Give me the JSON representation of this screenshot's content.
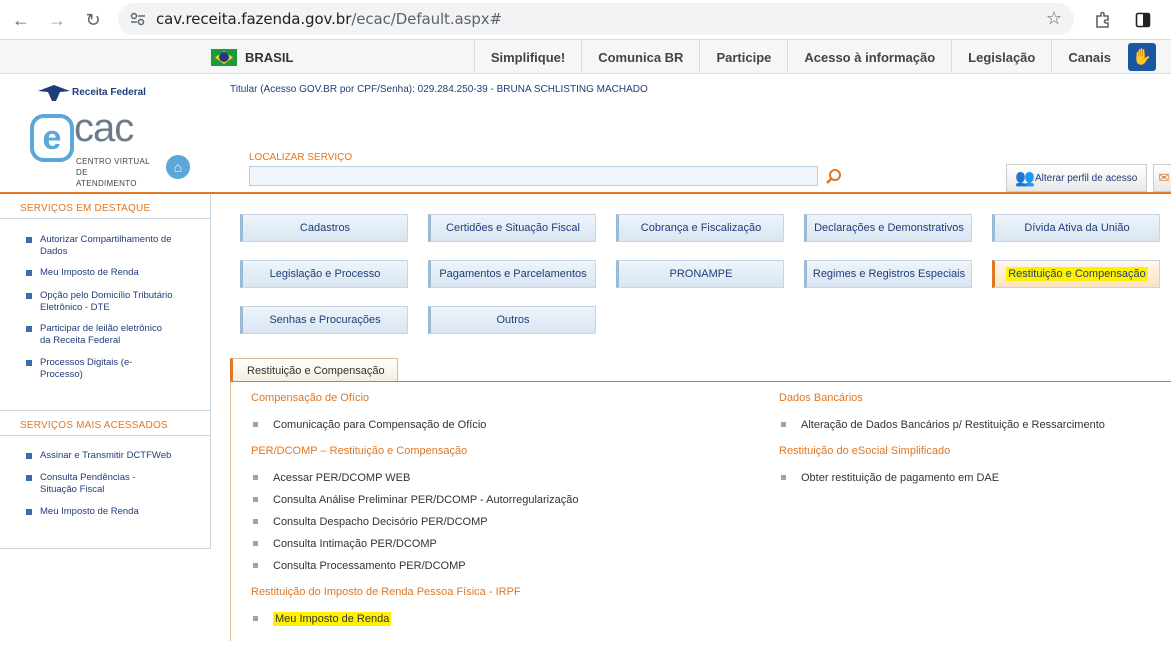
{
  "browser": {
    "url_host": "cav.receita.fazenda.gov.br",
    "url_path": "/ecac/Default.aspx#"
  },
  "gov_bar": {
    "country": "BRASIL",
    "links": [
      "Simplifique!",
      "Comunica BR",
      "Participe",
      "Acesso à informação",
      "Legislação",
      "Canais"
    ]
  },
  "header": {
    "rf_logo_text": "Receita Federal",
    "ecac_e": "e",
    "ecac_cac": "cac",
    "ecac_sub1": "CENTRO VIRTUAL",
    "ecac_sub2": "DE ATENDIMENTO",
    "titular": "Titular (Acesso GOV.BR por CPF/Senha): 029.284.250-39 - BRUNA SCHLISTING MACHADO",
    "search_label": "LOCALIZAR SERVIÇO",
    "search_value": "",
    "profile_button": "Alterar perfil de acesso"
  },
  "sidebar": {
    "featured_title": "SERVIÇOS EM DESTAQUE",
    "featured": [
      [
        "Autorizar Compartilhamento de",
        "Dados"
      ],
      [
        "Meu Imposto de Renda"
      ],
      [
        "Opção pelo Domicílio Tributário",
        "Eletrônico - DTE"
      ],
      [
        "Participar de leilão eletrônico",
        "da Receita Federal"
      ],
      [
        "Processos Digitais (e-",
        "Processo)"
      ]
    ],
    "most_title": "SERVIÇOS MAIS ACESSADOS",
    "most": [
      [
        "Assinar e Transmitir DCTFWeb"
      ],
      [
        "Consulta Pendências -",
        "Situação Fiscal"
      ],
      [
        "Meu Imposto de Renda"
      ]
    ]
  },
  "menu": [
    "Cadastros",
    "Certidões e Situação Fiscal",
    "Cobrança e Fiscalização",
    "Declarações e Demonstrativos",
    "Dívida Ativa da União",
    "Legislação e Processo",
    "Pagamentos e Parcelamentos",
    "PRONAMPE",
    "Regimes e Registros Especiais",
    "Restituição e Compensação",
    "Senhas e Procurações",
    "Outros"
  ],
  "tab_label": "Restituição e Compensação",
  "content": {
    "left": [
      {
        "title": "Compensação de Ofício",
        "items": [
          "Comunicação para Compensação de Ofício"
        ]
      },
      {
        "title": "PER/DCOMP – Restituição e Compensação",
        "items": [
          "Acessar PER/DCOMP WEB",
          "Consulta Análise Preliminar PER/DCOMP - Autorregularização",
          "Consulta Despacho Decisório PER/DCOMP",
          "Consulta Intimação PER/DCOMP",
          "Consulta Processamento PER/DCOMP"
        ]
      },
      {
        "title": "Restituição do Imposto de Renda Pessoa Física - IRPF",
        "items": [
          "Meu Imposto de Renda"
        ]
      }
    ],
    "right": [
      {
        "title": "Dados Bancários",
        "items": [
          "Alteração de Dados Bancários p/ Restituição e Ressarcimento"
        ]
      },
      {
        "title": "Restituição do eSocial Simplificado",
        "items": [
          "Obter restituição de pagamento em DAE"
        ]
      }
    ]
  },
  "colors": {
    "accent": "#e07722",
    "link_blue": "#1f3d7a",
    "highlight": "#fff100"
  }
}
